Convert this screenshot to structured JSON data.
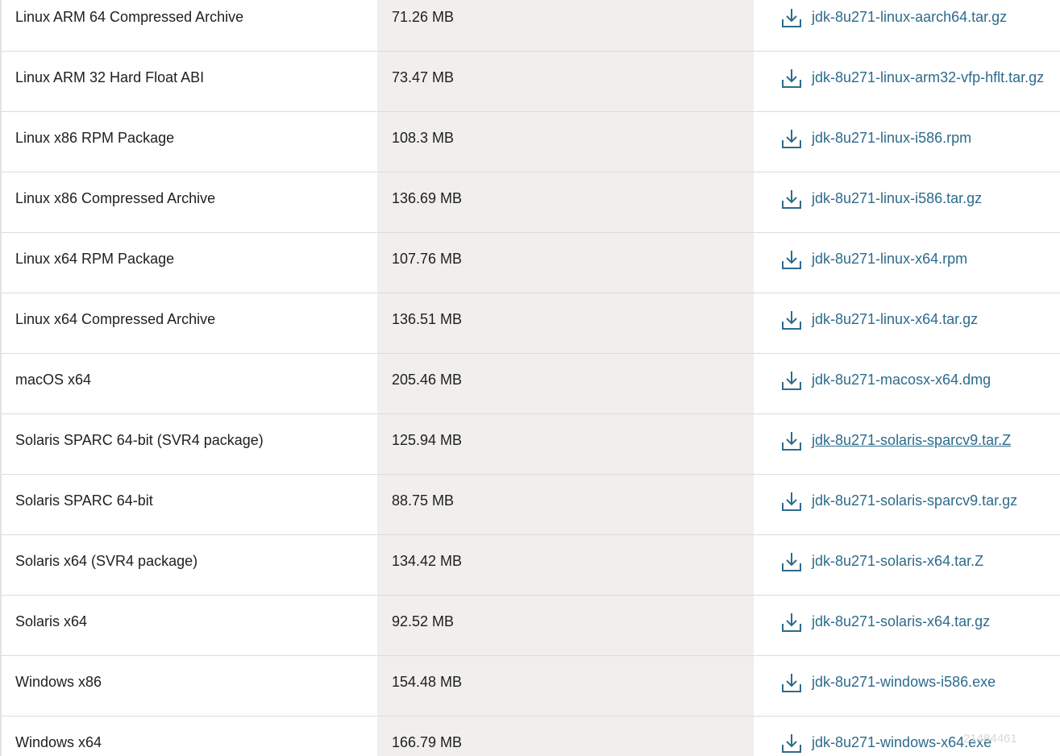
{
  "accent_color": "#2d6b8c",
  "download_icon": "download-icon",
  "rows": [
    {
      "product": "Linux ARM 64 Compressed Archive",
      "size": "71.26 MB",
      "file": "jdk-8u271-linux-aarch64.tar.gz"
    },
    {
      "product": "Linux ARM 32 Hard Float ABI",
      "size": "73.47 MB",
      "file": "jdk-8u271-linux-arm32-vfp-hflt.tar.gz"
    },
    {
      "product": "Linux x86 RPM Package",
      "size": "108.3 MB",
      "file": "jdk-8u271-linux-i586.rpm"
    },
    {
      "product": "Linux x86 Compressed Archive",
      "size": "136.69 MB",
      "file": "jdk-8u271-linux-i586.tar.gz"
    },
    {
      "product": "Linux x64 RPM Package",
      "size": "107.76 MB",
      "file": "jdk-8u271-linux-x64.rpm"
    },
    {
      "product": "Linux x64 Compressed Archive",
      "size": "136.51 MB",
      "file": "jdk-8u271-linux-x64.tar.gz"
    },
    {
      "product": "macOS x64",
      "size": "205.46 MB",
      "file": "jdk-8u271-macosx-x64.dmg"
    },
    {
      "product": "Solaris SPARC 64-bit (SVR4 package)",
      "size": "125.94 MB",
      "file": "jdk-8u271-solaris-sparcv9.tar.Z"
    },
    {
      "product": "Solaris SPARC 64-bit",
      "size": "88.75 MB",
      "file": "jdk-8u271-solaris-sparcv9.tar.gz"
    },
    {
      "product": "Solaris x64 (SVR4 package)",
      "size": "134.42 MB",
      "file": "jdk-8u271-solaris-x64.tar.Z"
    },
    {
      "product": "Solaris x64",
      "size": "92.52 MB",
      "file": "jdk-8u271-solaris-x64.tar.gz"
    },
    {
      "product": "Windows x86",
      "size": "154.48 MB",
      "file": "jdk-8u271-windows-i586.exe"
    },
    {
      "product": "Windows x64",
      "size": "166.79 MB",
      "file": "jdk-8u271-windows-x64.exe"
    }
  ],
  "watermark": "21484461"
}
